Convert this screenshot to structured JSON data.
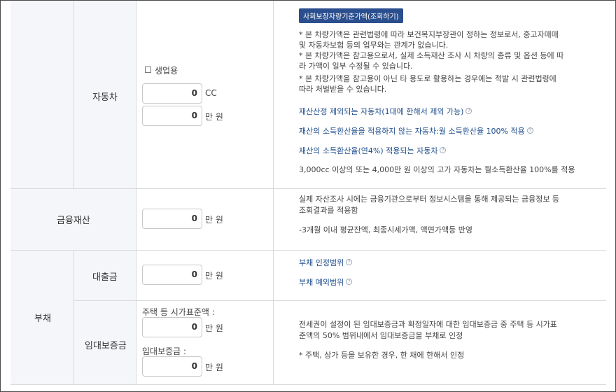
{
  "car": {
    "header": "자동차",
    "business_label": "생업용",
    "cc_value": "0",
    "cc_unit": "CC",
    "price_value": "0",
    "price_unit": "만 원",
    "badge": "사회보장자량기준가액(조회하기)",
    "notes": [
      "* 본 차량가액은 관련법령에 따라 보건복지부장관이 정하는 정보로서, 중고자매매",
      "및 자동차보험 등의 업무와는 관계가 없습니다.",
      "* 본 차량가액은 참고용으로서, 실제 소득재산 조사 시 차량의 종류 및 옵션 등에 따",
      "라 가액이 일부 수정될 수 있습니다.",
      "* 본 차량가액을 참고용이 아닌 타 용도로 활용하는 경우에는 적발 시 관련법령에",
      "따라 처벌받을 수 있습니다."
    ],
    "links": [
      "재산산정 제외되는 자동차(1대에 한해서 제외 가능)",
      "재산의 소득환산율을 적용하지 않는 자동차:월 소득환산율 100% 적용",
      "재산의 소득환산율(연4%) 적용되는 자동차"
    ],
    "footnote": "3,000cc 이상의 또는 4,000만 원 이상의 고가 자동차는 월소득환산율 100%를 적용"
  },
  "finance": {
    "header": "금융재산",
    "value": "0",
    "unit": "만 원",
    "notes": [
      "실제 자산조사 시에는 금융기관으로부터 정보시스템을 통해 제공되는 금융정보 등",
      "조회결과를 적용함"
    ],
    "note2": "-3개월 이내 평균잔액, 최종시세가액, 액면가액등 반영"
  },
  "debt": {
    "header": "부채",
    "loan": {
      "header": "대출금",
      "value": "0",
      "unit": "만 원",
      "links": [
        "부채 인정범위",
        "부채 예외범위"
      ]
    },
    "deposit": {
      "header": "임대보증금",
      "label1": "주택 등 시가표준액 :",
      "value1": "0",
      "unit1": "만 원",
      "label2": "임대보증금 :",
      "value2": "0",
      "unit2": "만 원",
      "notes": [
        "전세권이 설정이 된 임대보증금과 확정일자에 대한 임대보증금 중 주택 등 시가표",
        "준액의 50% 범위내에서 임대보증금을 부채로 인정"
      ],
      "note2": "* 주택, 상가 등을 보유한 경우, 한 채에 한해서 인정"
    }
  },
  "colors": {
    "header_bg": "#f4f6fa",
    "link": "#1f4e8c",
    "badge_bg": "#2b4f8e",
    "border": "#d9d9d9"
  }
}
